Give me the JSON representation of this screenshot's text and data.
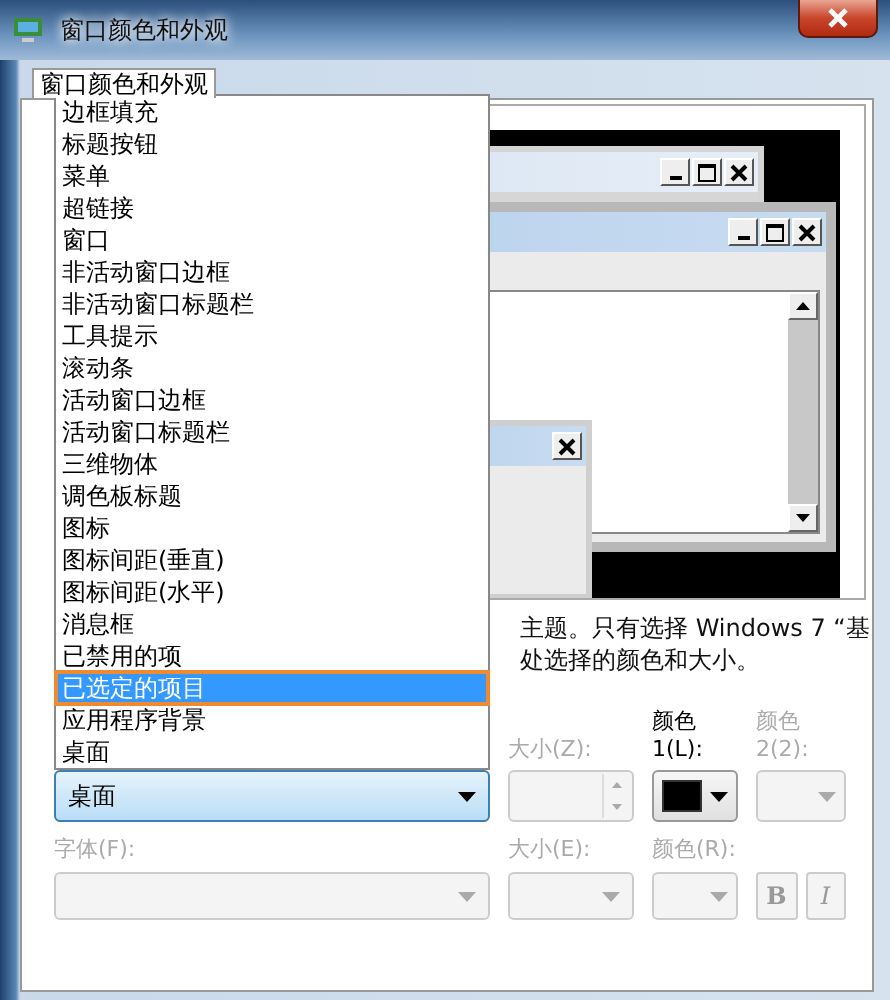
{
  "window": {
    "title": "窗口颜色和外观"
  },
  "tabs": [
    {
      "label": "窗口颜色和外观",
      "selected": true
    }
  ],
  "item_list": [
    {
      "label": "边框填充",
      "selected": false
    },
    {
      "label": "标题按钮",
      "selected": false
    },
    {
      "label": "菜单",
      "selected": false
    },
    {
      "label": "超链接",
      "selected": false
    },
    {
      "label": "窗口",
      "selected": false
    },
    {
      "label": "非活动窗口边框",
      "selected": false
    },
    {
      "label": "非活动窗口标题栏",
      "selected": false
    },
    {
      "label": "工具提示",
      "selected": false
    },
    {
      "label": "滚动条",
      "selected": false
    },
    {
      "label": "活动窗口边框",
      "selected": false
    },
    {
      "label": "活动窗口标题栏",
      "selected": false
    },
    {
      "label": "三维物体",
      "selected": false
    },
    {
      "label": "调色板标题",
      "selected": false
    },
    {
      "label": "图标",
      "selected": false
    },
    {
      "label": "图标间距(垂直)",
      "selected": false
    },
    {
      "label": "图标间距(水平)",
      "selected": false
    },
    {
      "label": "消息框",
      "selected": false
    },
    {
      "label": "已禁用的项",
      "selected": false
    },
    {
      "label": "已选定的项目",
      "selected": true
    },
    {
      "label": "应用程序背景",
      "selected": false
    },
    {
      "label": "桌面",
      "selected": false
    }
  ],
  "description_lines": [
    "主题。只有选择 Windows 7 “基",
    "处选择的颜色和大小。"
  ],
  "item_row": [
    {
      "kind": "combo",
      "value": "桌面",
      "disabled": false
    },
    {
      "kind": "spin",
      "label": "大小(Z):",
      "disabled": true
    },
    {
      "kind": "color",
      "label": "颜色 1(L):",
      "disabled": false,
      "color": "#000000"
    },
    {
      "kind": "color",
      "label": "颜色 2(2):",
      "disabled": true
    }
  ],
  "font_row": [
    {
      "kind": "combo",
      "label": "字体(F):",
      "disabled": true
    },
    {
      "kind": "combo",
      "label": "大小(E):",
      "disabled": true
    },
    {
      "kind": "color",
      "label": "颜色(R):",
      "disabled": true
    },
    {
      "kind": "toggles",
      "toggles": [
        {
          "text": "B",
          "kind": "bold",
          "disabled": true
        },
        {
          "text": "I",
          "kind": "italic",
          "disabled": true
        }
      ]
    }
  ]
}
